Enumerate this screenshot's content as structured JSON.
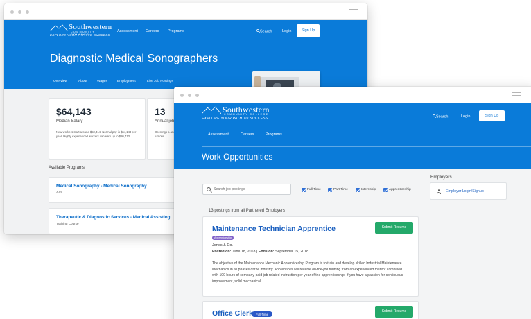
{
  "colors": {
    "brand_blue": "#0a7bd9",
    "link_blue": "#1a5fbf",
    "success_green": "#24a96a",
    "badge_purple": "#8062c9"
  },
  "brand": {
    "name": "Southwestern",
    "sub": "COMMUNITY COLLEGE",
    "tagline": "EXPLORE YOUR PATH TO SUCCESS"
  },
  "back": {
    "nav": {
      "assessment": "Assessment",
      "careers": "Careers",
      "programs": "Programs",
      "search": "Search",
      "login": "Login",
      "signup": "Sign Up"
    },
    "title": "Diagnostic Medical Sonographers",
    "subnav": [
      "Overview",
      "About",
      "Wages",
      "Employment",
      "Live Job Postings"
    ],
    "salary": {
      "value": "$64,143",
      "label": "Median Salary",
      "desc": "New workers start around $50,414. Normal pay is $64,143 per year. Highly experienced workers can earn up to $80,713."
    },
    "jobs_card": {
      "value": "13",
      "label": "Annual job",
      "desc": "Openings a and turnove"
    },
    "available_label": "Available Programs",
    "programs": [
      {
        "title": "Medical Sonography - Medical Sonography",
        "type": "AAS"
      },
      {
        "title": "Therapeutic & Diagnostic Services - Medical Assisting",
        "type": "Training Course"
      }
    ]
  },
  "front": {
    "nav": {
      "search": "Search",
      "login": "Login",
      "signup": "Sign Up"
    },
    "subnav": [
      "Assessment",
      "Careers",
      "Programs"
    ],
    "title": "Work Opportunities",
    "search_placeholder": "Search job postings",
    "filters": [
      "Full-Time",
      "Part-Time",
      "Internship",
      "Apprenticeship"
    ],
    "count_text": "13 postings from all Partnered Employers",
    "employers": {
      "heading": "Employers",
      "link": "Employer Login/Signup"
    },
    "jobs": [
      {
        "title": "Maintenance Technician Apprentice",
        "badge": "Apprenticeship",
        "company": "Jones & Co.",
        "posted_label": "Posted on:",
        "posted": "June 18, 2018",
        "ends_label": "Ends on:",
        "ends": "September 15, 2018",
        "desc": "The objective of the Maintenance Mechanic Apprenticeship Program is to train and develop skilled Industrial Maintenance Mechanics in all phases of the industry. Apprentices will receive on-the-job training from an experienced mentor combined with 100 hours of company-paid job related instruction per year of the apprenticeship. If you have a passion for continuous improvement, solid mechanical...",
        "submit": "Submit Resume"
      },
      {
        "title": "Office Clerk",
        "badge": "Full-Time",
        "submit": "Submit Resume"
      }
    ]
  }
}
